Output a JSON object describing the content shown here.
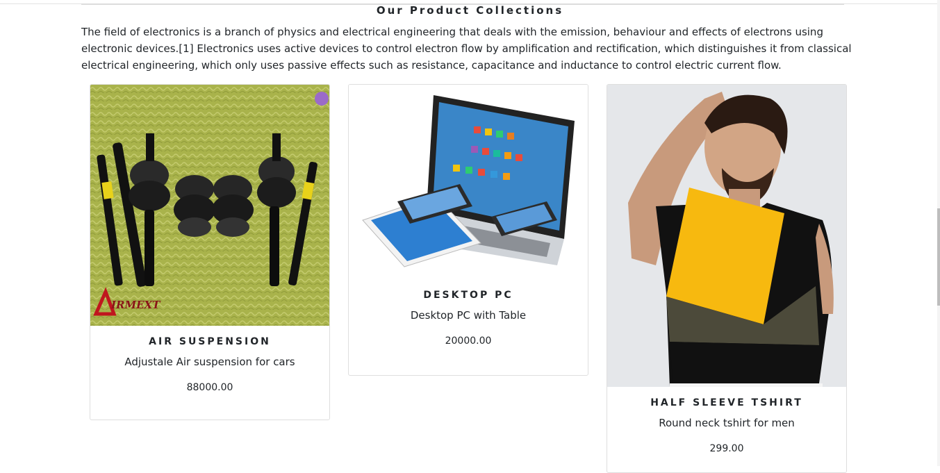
{
  "section": {
    "title": "Our Product Collections",
    "intro": "The field of electronics is a branch of physics and electrical engineering that deals with the emission, behaviour and effects of electrons using electronic devices.[1] Electronics uses active devices to control electron flow by amplification and rectification, which distinguishes it from classical electrical engineering, which only uses passive effects such as resistance, capacitance and inductance to control electric current flow."
  },
  "products": [
    {
      "name": "AIR SUSPENSION",
      "description": "Adjustale Air suspension for cars",
      "price": "88000.00",
      "image": "air-suspension-photo",
      "logo_text": "IRMEXT"
    },
    {
      "name": "DESKTOP PC",
      "description": "Desktop PC with Table",
      "price": "20000.00",
      "image": "laptop-tablet-phone-photo"
    },
    {
      "name": "HALF SLEEVE TSHIRT",
      "description": "Round neck tshirt for men",
      "price": "299.00",
      "image": "man-in-tshirt-photo"
    }
  ],
  "colors": {
    "text": "#212529",
    "border": "#dedede",
    "tshirt_yellow": "#f7b90f",
    "tshirt_olive": "#4c4a3a",
    "grass": "#a8b24a"
  }
}
